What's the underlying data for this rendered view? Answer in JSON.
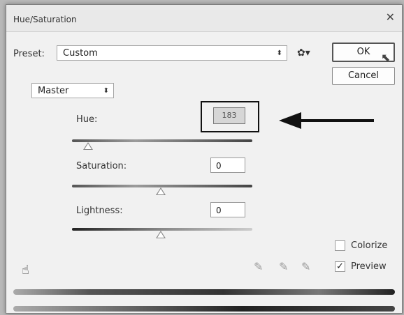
{
  "window": {
    "title": "Hue/Saturation",
    "close_glyph": "✕"
  },
  "preset": {
    "label": "Preset:",
    "value": "Custom"
  },
  "buttons": {
    "ok": "OK",
    "cancel": "Cancel"
  },
  "channel": {
    "value": "Master"
  },
  "hue": {
    "label": "Hue:",
    "value": "183"
  },
  "saturation": {
    "label": "Saturation:",
    "value": "0"
  },
  "lightness": {
    "label": "Lightness:",
    "value": "0"
  },
  "options": {
    "colorize": "Colorize",
    "preview": "Preview",
    "colorize_checked": false,
    "preview_checked": true
  },
  "icons": {
    "settings": "gear-icon",
    "adjust": "hand-icon",
    "pickers": [
      "eyedropper-icon",
      "eyedropper-plus-icon",
      "eyedropper-minus-icon"
    ]
  },
  "annotation": {
    "arrow": "pointing-arrow"
  }
}
